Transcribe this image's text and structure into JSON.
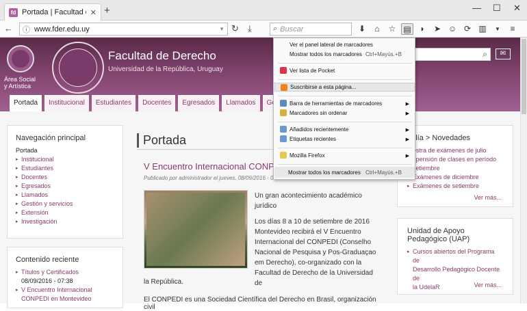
{
  "browser": {
    "tab_title": "Portada | Facultad de Dere...",
    "url": "www.fder.edu.uy",
    "search_placeholder": "Buscar",
    "fav_letter": "fd"
  },
  "header": {
    "title": "Facultad de Derecho",
    "subtitle": "Universidad de la República, Uruguay",
    "logo_caption": "Área Social y Artística"
  },
  "menu": [
    "Portada",
    "Institucional",
    "Estudiantes",
    "Docentes",
    "Egresados",
    "Llamados",
    "Gestión y ser"
  ],
  "nav_box": {
    "title": "Navegación principal",
    "current": "Portada",
    "items": [
      "Institucional",
      "Estudiantes",
      "Docentes",
      "Egresados",
      "Llamados",
      "Gestión y servicios",
      "Extensión",
      "Investigación"
    ]
  },
  "recent_box": {
    "title": "Contenido reciente",
    "items": [
      "Títulos y Certificados",
      "08/09/2016 - 07:38",
      "V Encuentro Internacional",
      "CONPEDI en Montevideo"
    ]
  },
  "main": {
    "title": "Portada",
    "article_title": "V Encuentro Internacional CONPEDI",
    "meta": "Publicado por administrador el jueves, 08/09/2016 - 0",
    "p1": "Un gran acontecimiento académico jurídico",
    "p2": "Los días 8 a 10 de setiembre de 2016 Montevideo recibirá el V Encuentro Internacional del CONPEDI (Conselho Nacional de Pesquisa y Pos-Graduaçao em Derecho), co-organizado con la Facultad de Derecho de la Universidad de",
    "p3": "la República.",
    "p4": "El CONPEDI es una Sociedad Científica del Derecho en Brasil, organización civil"
  },
  "news_box": {
    "title": "delía > Novedades",
    "items": [
      "estra de exámenes de julio",
      "spensión de clases en período",
      "setiembre",
      "Exámenes de diciembre",
      "Exámenes de setiembre"
    ],
    "more": "Ver más..."
  },
  "uap_box": {
    "title": "Unidad de Apoyo Pedagógico (UAP)",
    "items": [
      "Cursos abiertos del Programa de",
      "Desarrollo Pedagógico Docente de",
      "la UdelaR"
    ],
    "more": "Ver más..."
  },
  "popup": {
    "items": [
      {
        "label": "Ver el panel lateral de marcadores",
        "acc": ""
      },
      {
        "label": "Mostrar todos los marcadores",
        "acc": "Ctrl+Mayús.+B"
      },
      {
        "label": "Ver lista de Pocket",
        "acc": ""
      },
      {
        "label": "Suscribirse a esta página...",
        "acc": ""
      },
      {
        "label": "Barra de herramientas de marcadores",
        "acc": ""
      },
      {
        "label": "Marcadores sin ordenar",
        "acc": ""
      },
      {
        "label": "Añadidos recientemente",
        "acc": ""
      },
      {
        "label": "Etiquetas recientes",
        "acc": ""
      },
      {
        "label": "Mozilla Firefox",
        "acc": ""
      },
      {
        "label": "Mostrar todos los marcadores",
        "acc": "Ctrl+Mayús.+B"
      }
    ]
  }
}
